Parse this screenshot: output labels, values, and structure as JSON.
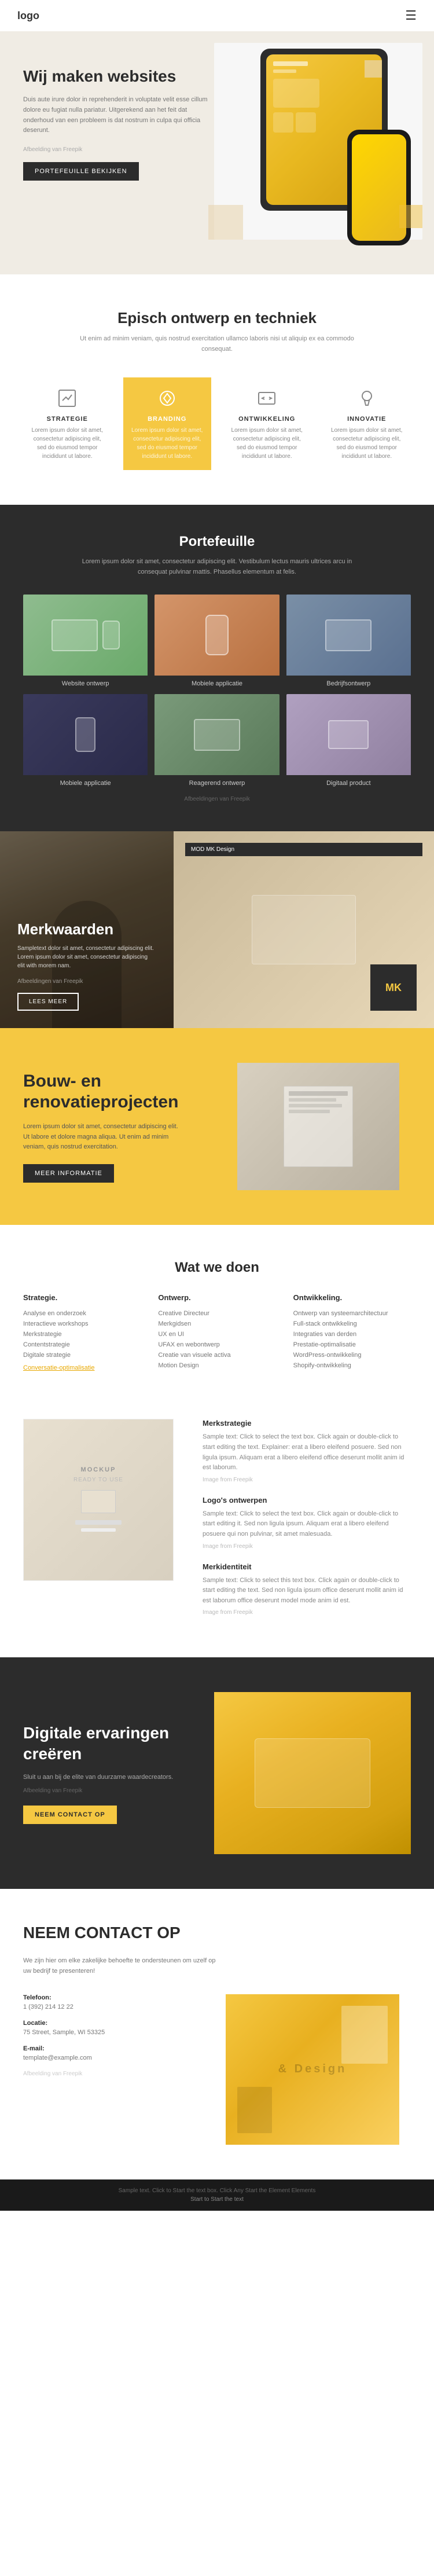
{
  "nav": {
    "logo": "logo",
    "menu_icon": "☰"
  },
  "hero": {
    "title": "Wij maken websites",
    "text": "Duis aute irure dolor in reprehenderit in voluptate velit esse cillum dolore eu fugiat nulla pariatur. Uitgerekend aan het feit dat onderhoud van een probleem is dat nostrum in culpa qui officia deserunt.",
    "attribution": "Afbeelding van Freepik",
    "button": "PORTEFEUILLE BEKIJKEN"
  },
  "epic": {
    "title": "Episch ontwerp en techniek",
    "text": "Ut enim ad minim veniam, quis nostrud exercitation ullamco laboris nisi ut aliquip ex ea commodo consequat.",
    "items": [
      {
        "title": "STRATEGIE",
        "text": "Lorem ipsum dolor sit amet, consectetur adipiscing elit, sed do eiusmod tempor incididunt ut labore.",
        "active": false,
        "icon": "strategy"
      },
      {
        "title": "BRANDING",
        "text": "Lorem ipsum dolor sit amet, consectetur adipiscing elit, sed do eiusmod tempor incididunt ut labore.",
        "active": true,
        "icon": "branding"
      },
      {
        "title": "ONTWIKKELING",
        "text": "Lorem ipsum dolor sit amet, consectetur adipiscing elit, sed do eiusmod tempor incididunt ut labore.",
        "active": false,
        "icon": "development"
      },
      {
        "title": "INNOVATIE",
        "text": "Lorem ipsum dolor sit amet, consectetur adipiscing elit, sed do eiusmod tempor incididunt ut labore.",
        "active": false,
        "icon": "innovation"
      }
    ]
  },
  "portfolio": {
    "title": "Portefeuille",
    "text": "Lorem ipsum dolor sit amet, consectetur adipiscing elit. Vestibulum lectus mauris ultrices arcu in consequat pulvinar mattis. Phasellus elementum at felis.",
    "items": [
      {
        "label": "Website ontwerp",
        "img_class": "p-img-1"
      },
      {
        "label": "Mobiele applicatie",
        "img_class": "p-img-2"
      },
      {
        "label": "Bedrijfsontwerp",
        "img_class": "p-img-3"
      },
      {
        "label": "Mobiele applicatie",
        "img_class": "p-img-4"
      },
      {
        "label": "Reagerend ontwerp",
        "img_class": "p-img-5"
      },
      {
        "label": "Digitaal product",
        "img_class": "p-img-6"
      }
    ],
    "attribution": "Afbeeldingen van Freepik"
  },
  "merkwaarden": {
    "title": "Merkwaarden",
    "text": "Sampletext dolor sit amet, consectetur adipiscing elit. Lorem ipsum dolor sit amet, consectetur adipiscing elit with morem nam.",
    "attribution": "Afbeeldingen van Freepik",
    "button": "LEES MEER",
    "badge": "MOD MK Design"
  },
  "bouw": {
    "title": "Bouw- en renovatieprojecten",
    "text": "Lorem ipsum dolor sit amet, consectetur adipiscing elit. Ut labore et dolore magna aliqua. Ut enim ad minim veniam, quis nostrud exercitation.",
    "button": "MEER INFORMATIE"
  },
  "watdoen": {
    "title": "Wat we doen",
    "columns": [
      {
        "title": "Strategie.",
        "items": [
          "Analyse en onderzoek",
          "Interactieve workshops",
          "Merkstrategie",
          "Contentstrategie",
          "Digitale strategie",
          "Conversatie-optimalisatie"
        ],
        "link": "Conversatie-optimalisatie"
      },
      {
        "title": "Ontwerp.",
        "items": [
          "Creative Directeur",
          "Merkgidsen",
          "UX en UI",
          "UFAX en webontwerp",
          "Creatie van visuele activa",
          "Motion Design"
        ],
        "link": null
      },
      {
        "title": "Ontwikkeling.",
        "items": [
          "Ontwerp van systeemarchitectuur",
          "Full-stack ontwikkeling",
          "Integraties van derden",
          "Prestatie-optimalisatie",
          "WordPress-ontwikkeling",
          "Shopify-ontwikkeling"
        ],
        "link": null
      }
    ]
  },
  "merkstrategie": {
    "mockup_text": "MOCKUP\nREADY TO USE",
    "sections": [
      {
        "title": "Merkstrategie",
        "text": "Sample text: Click to select the text box. Click again or double-click to start editing the text. Explainer: erat a libero eleifend posuere. Sed non ligula ipsum. Aliquam erat a libero eleifend office deserunt mollit anim id est laborum.",
        "attribution": "Image from Freepik"
      },
      {
        "title": "Logo's ontwerpen",
        "text": "Sample text: Click to select the text box. Click again or double-click to start editing it. Sed non ligula ipsum. Aliquam erat a libero eleifend posuere qui non pulvinar, sit amet malesuada.",
        "attribution": "Image from Freepik"
      },
      {
        "title": "Merkidentiteit",
        "text": "Sample text: Click to select this text box. Click again or double-click to start editing the text. Sed non ligula ipsum office deserunt mollit anim id est laborum office deserunt model mode anim id est.",
        "attribution": "Image from Freepik"
      }
    ]
  },
  "digitale": {
    "title": "Digitale ervaringen creëren",
    "text": "Sluit u aan bij de elite van duurzame waardecreators.",
    "attribution": "Afbeelding van Freepik",
    "button": "NEEM CONTACT OP"
  },
  "contact": {
    "title": "NEEM CONTACT OP",
    "intro": "We zijn hier om elke zakelijke behoefte te ondersteunen om uzelf op uw bedrijf te presenteren!",
    "items": [
      {
        "label": "Telefoon:",
        "value": "1 (392) 214 12 22"
      },
      {
        "label": "Locatie:",
        "value": "75 Street, Sample, WI 53325"
      },
      {
        "label": "E-mail:",
        "value": "template@example.com"
      }
    ],
    "attribution": "Afbeelding van Freepik"
  },
  "footer": {
    "text": "Sample text. Click to Start the text box. Click Any Start the Element Elements",
    "links": "Start to Start the text"
  }
}
